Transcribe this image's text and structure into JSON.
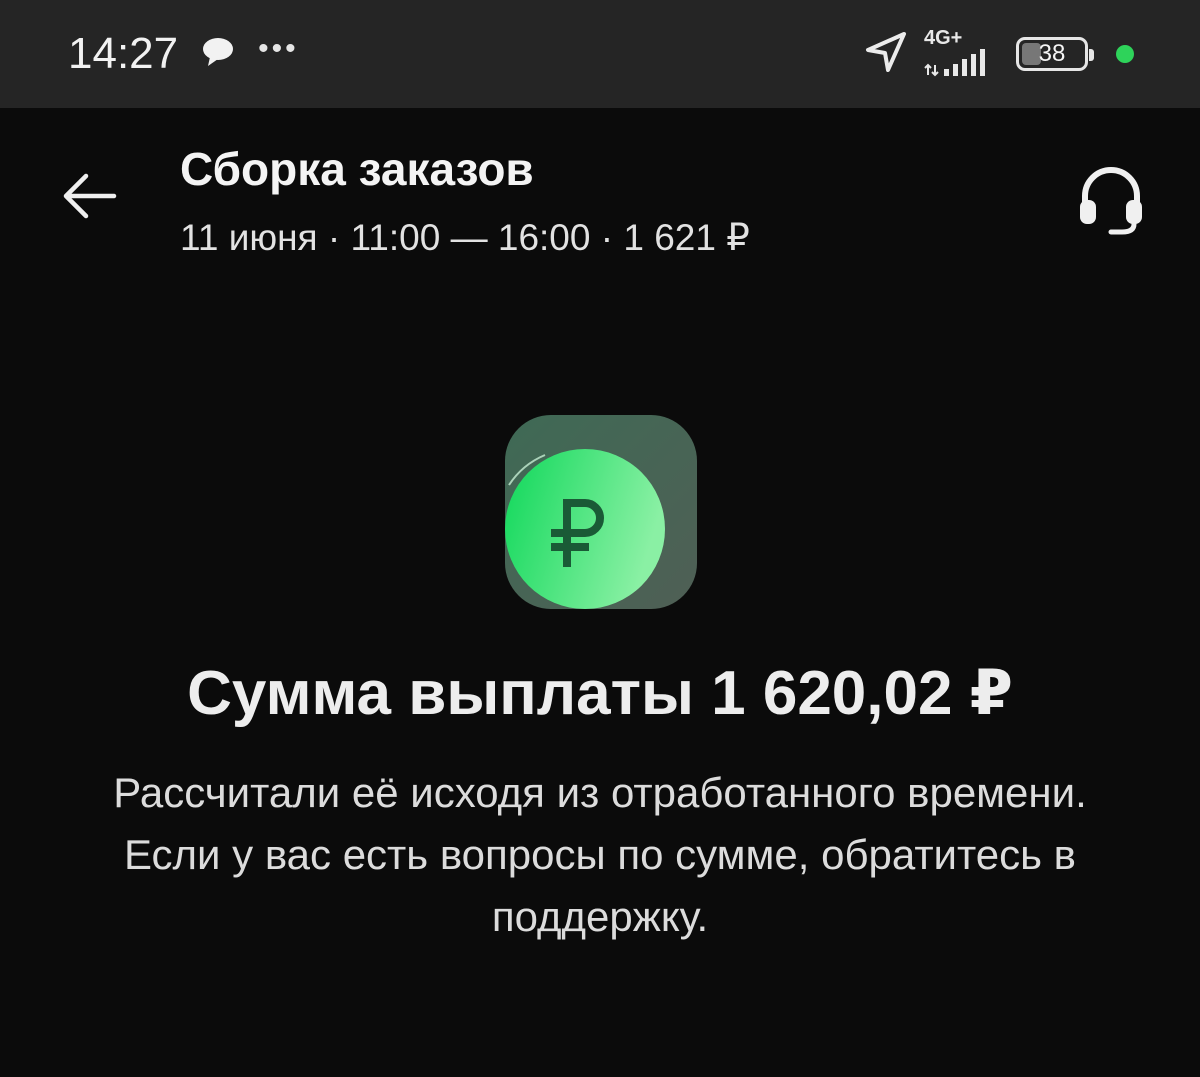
{
  "status_bar": {
    "time": "14:27",
    "network": "4G+",
    "battery": "38",
    "battery_level_percent": 38
  },
  "header": {
    "title": "Сборка заказов",
    "subtitle": "11 июня · 11:00 — 16:00 · 1 621 ₽"
  },
  "icons": {
    "back": "arrow-left-icon",
    "support": "headset-icon",
    "coin": "ruble-coin-icon"
  },
  "payout": {
    "title": "Сумма выплаты 1 620,02 ₽",
    "description": "Рассчитали её исходя из отработанного времени. Если у вас есть вопросы по сумме, обратитесь в поддержку."
  },
  "colors": {
    "background": "#0b0b0b",
    "status_bar": "#252525",
    "accent_green": "#1fe066",
    "status_dot": "#2ed35a"
  }
}
